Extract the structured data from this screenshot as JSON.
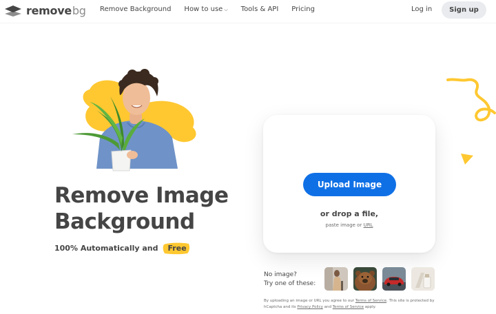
{
  "brand": {
    "name": "remove",
    "suffix": "bg"
  },
  "nav": {
    "links": [
      "Remove Background",
      "How to use",
      "Tools & API",
      "Pricing"
    ],
    "login": "Log in",
    "signup": "Sign up"
  },
  "hero": {
    "title_line1": "Remove Image",
    "title_line2": "Background",
    "subtitle": "100% Automatically and",
    "badge": "Free"
  },
  "upload": {
    "button": "Upload Image",
    "drop_text": "or drop a file,",
    "paste_text": "paste image or",
    "url_link": "URL"
  },
  "samples": {
    "label_line1": "No image?",
    "label_line2": "Try one of these:"
  },
  "legal": {
    "part1": "By uploading an image or URL you agree to our",
    "tos1": "Terms of Service",
    "part2": ". This site is protected by hCaptcha and its",
    "privacy": "Privacy Policy",
    "part3": "and",
    "tos2": "Terms of Service",
    "part4": "apply."
  },
  "colors": {
    "primary": "#0f70e6",
    "accent_yellow": "#ffc831",
    "text": "#454545"
  }
}
